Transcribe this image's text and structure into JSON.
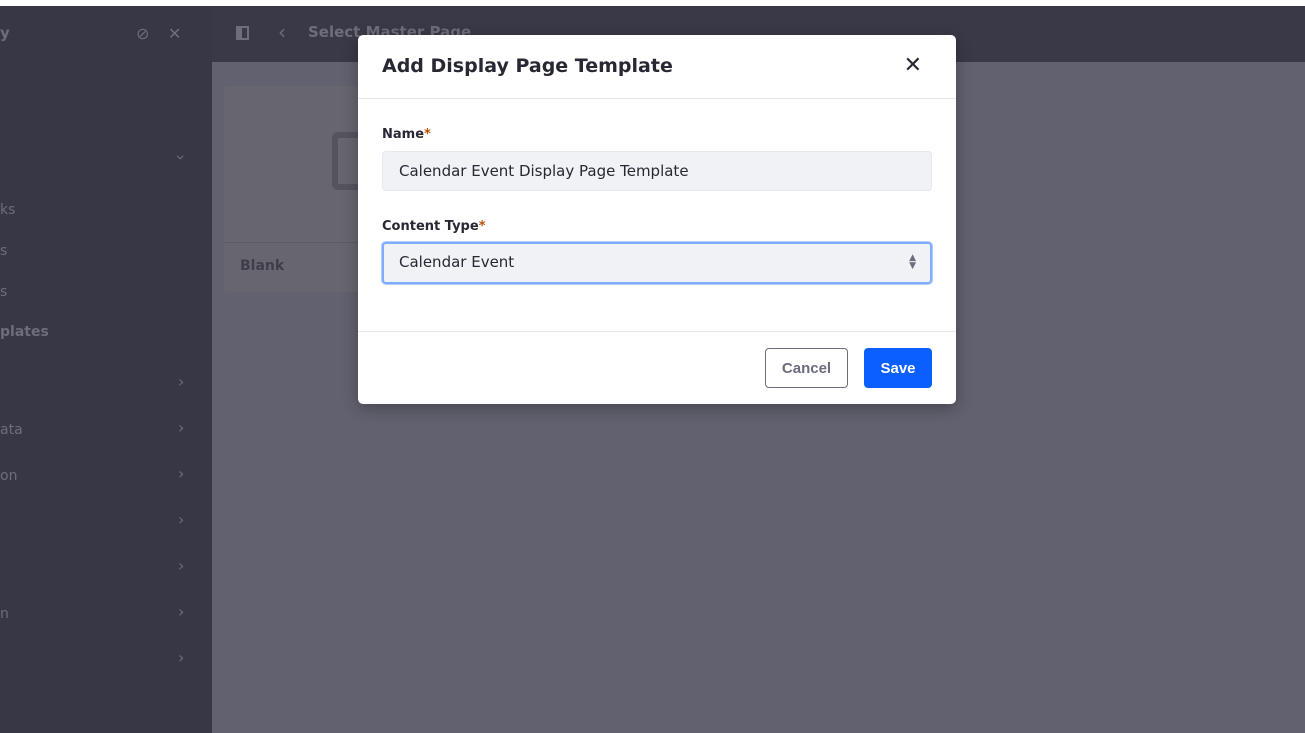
{
  "sidebar": {
    "title": "y",
    "items": [
      {
        "label": "ks"
      },
      {
        "label": "s"
      },
      {
        "label": "s"
      },
      {
        "label": "plates"
      },
      {
        "label": ""
      },
      {
        "label": "ata"
      },
      {
        "label": "on"
      },
      {
        "label": ""
      },
      {
        "label": ""
      },
      {
        "label": "n"
      },
      {
        "label": ""
      }
    ]
  },
  "header": {
    "title": "Select Master Page"
  },
  "card": {
    "label": "Blank"
  },
  "modal": {
    "title": "Add Display Page Template",
    "name_label": "Name",
    "name_value": "Calendar Event Display Page Template",
    "content_type_label": "Content Type",
    "content_type_value": "Calendar Event",
    "required_mark": "*",
    "cancel_label": "Cancel",
    "save_label": "Save"
  },
  "colors": {
    "primary": "#0b5fff",
    "required": "#b95000",
    "focus": "#80acff"
  }
}
